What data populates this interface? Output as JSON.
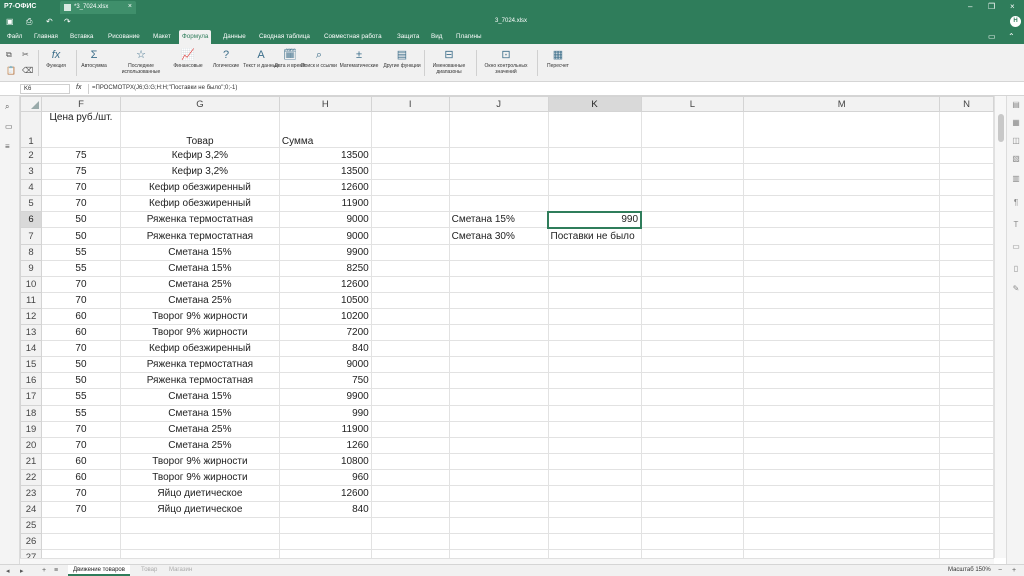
{
  "titlebar": {
    "app_name": "Р7-ОФИС",
    "doc_tab": "*3_7024.xlsx",
    "file_title": "3_7024.xlsx",
    "avatar_letter": "Н"
  },
  "menu": {
    "tabs": [
      "Файл",
      "Главная",
      "Вставка",
      "Рисование",
      "Макет",
      "Формула",
      "Данные",
      "Сводная таблица",
      "Совместная работа",
      "Защита",
      "Вид",
      "Плагины"
    ],
    "active": "Формула"
  },
  "ribbon": {
    "function": "Функция",
    "autosum": "Автосумма",
    "recent": "Последние использованные",
    "financial": "Финансовые",
    "logical": "Логические",
    "text_data": "Текст и данные",
    "date_time": "Дата и время",
    "lookup": "Поиск и ссылки",
    "math": "Математические",
    "other": "Другие функции",
    "named_ranges": "Именованные диапазоны",
    "watch_window": "Окно контрольных значений",
    "recalc": "Пересчет"
  },
  "formula_bar": {
    "cell_ref": "K6",
    "fx": "fx",
    "formula": "=ПРОСМОТРX(J6;G:G;H:H;\"Поставки не было\";0;-1)"
  },
  "grid": {
    "columns": [
      "F",
      "G",
      "H",
      "I",
      "J",
      "K",
      "L",
      "M",
      "N"
    ],
    "selected_column": "K",
    "selected_row": "6",
    "header_row": {
      "F": "Цена руб./шт.",
      "G": "Товар",
      "H": "Сумма"
    },
    "rows": [
      {
        "n": "2",
        "F": "75",
        "G": "Кефир 3,2%",
        "H": "13500"
      },
      {
        "n": "3",
        "F": "75",
        "G": "Кефир 3,2%",
        "H": "13500"
      },
      {
        "n": "4",
        "F": "70",
        "G": "Кефир обезжиренный",
        "H": "12600"
      },
      {
        "n": "5",
        "F": "70",
        "G": "Кефир обезжиренный",
        "H": "11900"
      },
      {
        "n": "6",
        "F": "50",
        "G": "Ряженка термостатная",
        "H": "9000",
        "J": "Сметана 15%",
        "K": "990"
      },
      {
        "n": "7",
        "F": "50",
        "G": "Ряженка термостатная",
        "H": "9000",
        "J": "Сметана 30%",
        "K": "Поставки не было"
      },
      {
        "n": "8",
        "F": "55",
        "G": "Сметана 15%",
        "H": "9900"
      },
      {
        "n": "9",
        "F": "55",
        "G": "Сметана 15%",
        "H": "8250"
      },
      {
        "n": "10",
        "F": "70",
        "G": "Сметана 25%",
        "H": "12600"
      },
      {
        "n": "11",
        "F": "70",
        "G": "Сметана 25%",
        "H": "10500"
      },
      {
        "n": "12",
        "F": "60",
        "G": "Творог 9% жирности",
        "H": "10200"
      },
      {
        "n": "13",
        "F": "60",
        "G": "Творог 9% жирности",
        "H": "7200"
      },
      {
        "n": "14",
        "F": "70",
        "G": "Кефир обезжиренный",
        "H": "840"
      },
      {
        "n": "15",
        "F": "50",
        "G": "Ряженка термостатная",
        "H": "9000"
      },
      {
        "n": "16",
        "F": "50",
        "G": "Ряженка термостатная",
        "H": "750"
      },
      {
        "n": "17",
        "F": "55",
        "G": "Сметана 15%",
        "H": "9900"
      },
      {
        "n": "18",
        "F": "55",
        "G": "Сметана 15%",
        "H": "990"
      },
      {
        "n": "19",
        "F": "70",
        "G": "Сметана 25%",
        "H": "11900"
      },
      {
        "n": "20",
        "F": "70",
        "G": "Сметана 25%",
        "H": "1260"
      },
      {
        "n": "21",
        "F": "60",
        "G": "Творог 9% жирности",
        "H": "10800"
      },
      {
        "n": "22",
        "F": "60",
        "G": "Творог 9% жирности",
        "H": "960"
      },
      {
        "n": "23",
        "F": "70",
        "G": "Яйцо диетическое",
        "H": "12600"
      },
      {
        "n": "24",
        "F": "70",
        "G": "Яйцо диетическое",
        "H": "840"
      },
      {
        "n": "25"
      },
      {
        "n": "26"
      },
      {
        "n": "27"
      }
    ]
  },
  "sheets": {
    "tabs": [
      "Движение товаров",
      "Товар",
      "Магазин"
    ],
    "active": "Движение товаров"
  },
  "status": {
    "zoom": "Масштаб 150%"
  },
  "colors": {
    "brand": "#2f7d5b",
    "active_cell_border": "#2f7d5b"
  }
}
